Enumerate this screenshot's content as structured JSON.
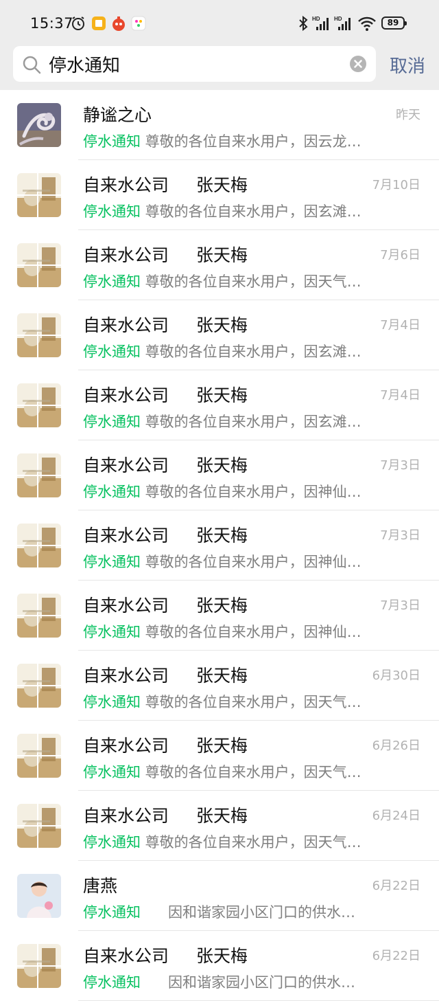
{
  "status_bar": {
    "time": "15:37",
    "battery": "89",
    "icons": [
      "alarm-icon",
      "notes-app-icon",
      "music-app-icon",
      "photos-app-icon",
      "bluetooth-icon",
      "signal-hd-icon",
      "signal-hd-icon",
      "wifi-icon",
      "battery-icon"
    ]
  },
  "search": {
    "query": "停水通知",
    "cancel_label": "取消"
  },
  "accent_colors": {
    "keyword": "#07c160",
    "cancel": "#576b95",
    "date": "#b2b2b2"
  },
  "results": [
    {
      "name": "静谧之心",
      "sender": "",
      "date": "昨天",
      "keyword": "停水通知",
      "text": " 尊敬的各位自来水用户，因云龙…",
      "avatar": "dragon"
    },
    {
      "name": "自来水公司",
      "sender": "张天梅",
      "date": "7月10日",
      "keyword": "停水通知",
      "text": " 尊敬的各位自来水用户，因玄滩…",
      "avatar": "photo"
    },
    {
      "name": "自来水公司",
      "sender": "张天梅",
      "date": "7月6日",
      "keyword": "停水通知",
      "text": " 尊敬的各位自来水用户，因天气…",
      "avatar": "photo"
    },
    {
      "name": "自来水公司",
      "sender": "张天梅",
      "date": "7月4日",
      "keyword": "停水通知",
      "text": " 尊敬的各位自来水用户，因玄滩…",
      "avatar": "photo"
    },
    {
      "name": "自来水公司",
      "sender": "张天梅",
      "date": "7月4日",
      "keyword": "停水通知",
      "text": " 尊敬的各位自来水用户，因玄滩…",
      "avatar": "photo"
    },
    {
      "name": "自来水公司",
      "sender": "张天梅",
      "date": "7月3日",
      "keyword": "停水通知",
      "text": " 尊敬的各位自来水用户，因神仙…",
      "avatar": "photo"
    },
    {
      "name": "自来水公司",
      "sender": "张天梅",
      "date": "7月3日",
      "keyword": "停水通知",
      "text": " 尊敬的各位自来水用户，因神仙…",
      "avatar": "photo"
    },
    {
      "name": "自来水公司",
      "sender": "张天梅",
      "date": "7月3日",
      "keyword": "停水通知",
      "text": " 尊敬的各位自来水用户，因神仙…",
      "avatar": "photo"
    },
    {
      "name": "自来水公司",
      "sender": "张天梅",
      "date": "6月30日",
      "keyword": "停水通知",
      "text": " 尊敬的各位自来水用户，因天气…",
      "avatar": "photo"
    },
    {
      "name": "自来水公司",
      "sender": "张天梅",
      "date": "6月26日",
      "keyword": "停水通知",
      "text": " 尊敬的各位自来水用户，因天气…",
      "avatar": "photo"
    },
    {
      "name": "自来水公司",
      "sender": "张天梅",
      "date": "6月24日",
      "keyword": "停水通知",
      "text": " 尊敬的各位自来水用户，因天气…",
      "avatar": "photo"
    },
    {
      "name": "唐燕",
      "sender": "",
      "date": "6月22日",
      "keyword": "停水通知",
      "text": "      因和谐家园小区门口的供水…",
      "avatar": "child"
    },
    {
      "name": "自来水公司",
      "sender": "张天梅",
      "date": "6月22日",
      "keyword": "停水通知",
      "text": "      因和谐家园小区门口的供水…",
      "avatar": "photo"
    }
  ]
}
